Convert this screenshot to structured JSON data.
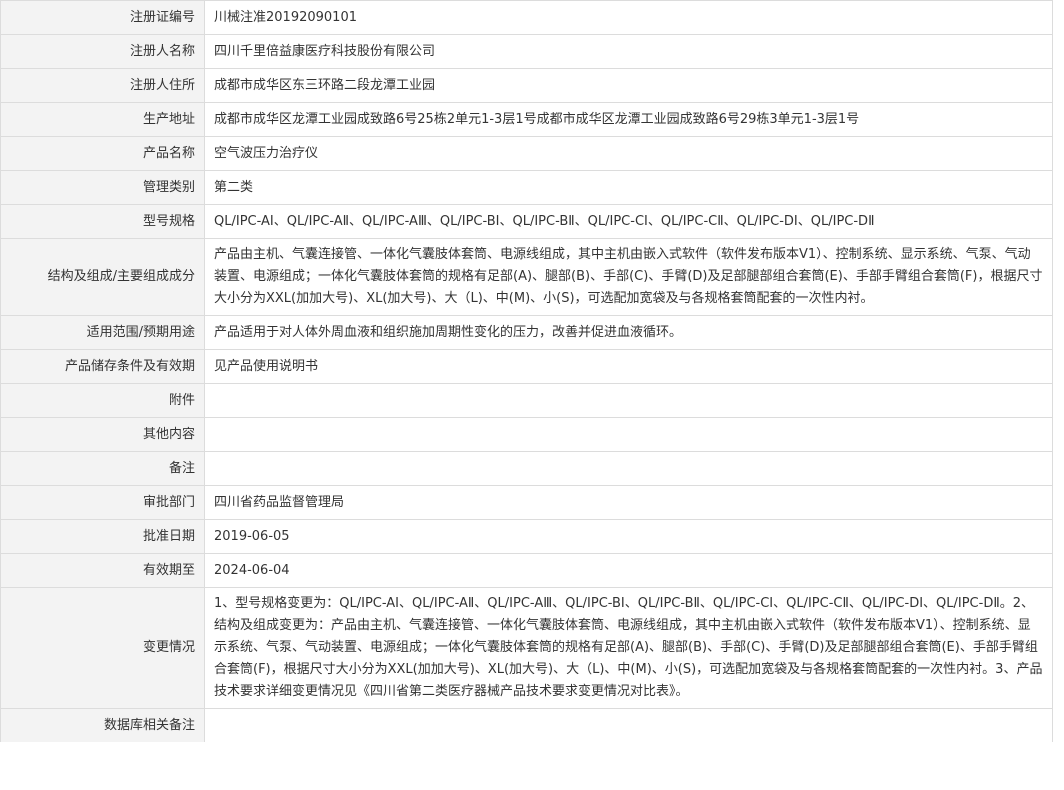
{
  "rows": [
    {
      "label": "注册证编号",
      "value": "川械注准20192090101"
    },
    {
      "label": "注册人名称",
      "value": "四川千里倍益康医疗科技股份有限公司"
    },
    {
      "label": "注册人住所",
      "value": "成都市成华区东三环路二段龙潭工业园"
    },
    {
      "label": "生产地址",
      "value": "成都市成华区龙潭工业园成致路6号25栋2单元1-3层1号成都市成华区龙潭工业园成致路6号29栋3单元1-3层1号"
    },
    {
      "label": "产品名称",
      "value": "空气波压力治疗仪"
    },
    {
      "label": "管理类别",
      "value": "第二类"
    },
    {
      "label": "型号规格",
      "value": "QL/IPC-AⅠ、QL/IPC-AⅡ、QL/IPC-AⅢ、QL/IPC-BⅠ、QL/IPC-BⅡ、QL/IPC-CⅠ、QL/IPC-CⅡ、QL/IPC-DⅠ、QL/IPC-DⅡ"
    },
    {
      "label": "结构及组成/主要组成成分",
      "value": "产品由主机、气囊连接管、一体化气囊肢体套筒、电源线组成，其中主机由嵌入式软件（软件发布版本V1）、控制系统、显示系统、气泵、气动装置、电源组成；一体化气囊肢体套筒的规格有足部(A)、腿部(B)、手部(C)、手臂(D)及足部腿部组合套筒(E)、手部手臂组合套筒(F)，根据尺寸大小分为XXL(加加大号)、XL(加大号)、大（L)、中(M)、小(S)，可选配加宽袋及与各规格套筒配套的一次性内衬。"
    },
    {
      "label": "适用范围/预期用途",
      "value": "产品适用于对人体外周血液和组织施加周期性变化的压力，改善并促进血液循环。"
    },
    {
      "label": "产品储存条件及有效期",
      "value": "见产品使用说明书"
    },
    {
      "label": "附件",
      "value": ""
    },
    {
      "label": "其他内容",
      "value": ""
    },
    {
      "label": "备注",
      "value": ""
    },
    {
      "label": "审批部门",
      "value": "四川省药品监督管理局"
    },
    {
      "label": "批准日期",
      "value": "2019-06-05"
    },
    {
      "label": "有效期至",
      "value": "2024-06-04"
    },
    {
      "label": "变更情况",
      "value": "1、型号规格变更为：QL/IPC-AⅠ、QL/IPC-AⅡ、QL/IPC-AⅢ、QL/IPC-BⅠ、QL/IPC-BⅡ、QL/IPC-CⅠ、QL/IPC-CⅡ、QL/IPC-DⅠ、QL/IPC-DⅡ。2、结构及组成变更为：产品由主机、气囊连接管、一体化气囊肢体套筒、电源线组成，其中主机由嵌入式软件（软件发布版本V1）、控制系统、显示系统、气泵、气动装置、电源组成；一体化气囊肢体套筒的规格有足部(A)、腿部(B)、手部(C)、手臂(D)及足部腿部组合套筒(E)、手部手臂组合套筒(F)，根据尺寸大小分为XXL(加加大号)、XL(加大号)、大（L)、中(M)、小(S)，可选配加宽袋及与各规格套筒配套的一次性内衬。3、产品技术要求详细变更情况见《四川省第二类医疗器械产品技术要求变更情况对比表》。"
    },
    {
      "label": "数据库相关备注",
      "value": ""
    }
  ]
}
